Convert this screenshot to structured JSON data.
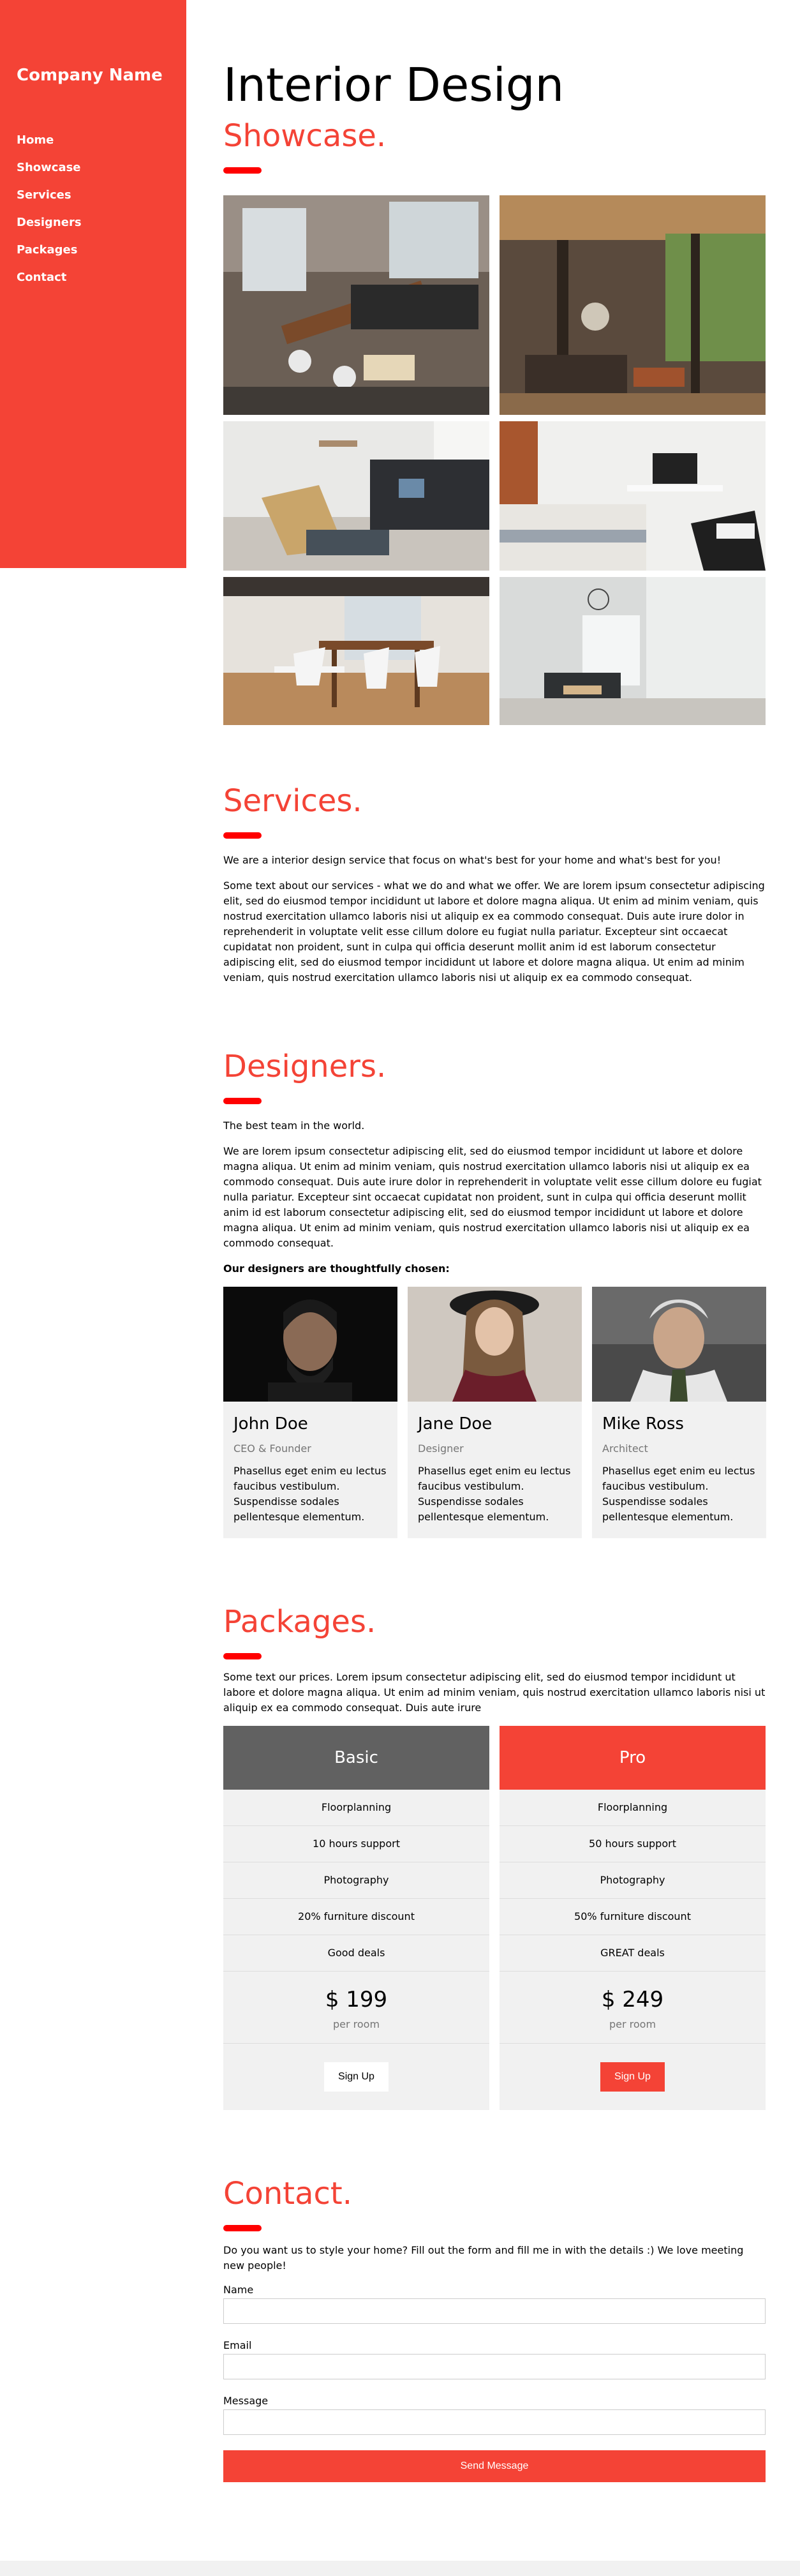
{
  "sidebar": {
    "brand": "Company Name",
    "nav": [
      "Home",
      "Showcase",
      "Services",
      "Designers",
      "Packages",
      "Contact"
    ]
  },
  "header": {
    "title": "Interior Design",
    "subtitle": "Showcase."
  },
  "services": {
    "title": "Services.",
    "intro": "We are a interior design service that focus on what's best for your home and what's best for you!",
    "body": "Some text about our services - what we do and what we offer. We are lorem ipsum consectetur adipiscing elit, sed do eiusmod tempor incididunt ut labore et dolore magna aliqua. Ut enim ad minim veniam, quis nostrud exercitation ullamco laboris nisi ut aliquip ex ea commodo consequat. Duis aute irure dolor in reprehenderit in voluptate velit esse cillum dolore eu fugiat nulla pariatur. Excepteur sint occaecat cupidatat non proident, sunt in culpa qui officia deserunt mollit anim id est laborum consectetur adipiscing elit, sed do eiusmod tempor incididunt ut labore et dolore magna aliqua. Ut enim ad minim veniam, quis nostrud exercitation ullamco laboris nisi ut aliquip ex ea commodo consequat."
  },
  "designers": {
    "title": "Designers.",
    "intro": "The best team in the world.",
    "body": "We are lorem ipsum consectetur adipiscing elit, sed do eiusmod tempor incididunt ut labore et dolore magna aliqua. Ut enim ad minim veniam, quis nostrud exercitation ullamco laboris nisi ut aliquip ex ea commodo consequat. Duis aute irure dolor in reprehenderit in voluptate velit esse cillum dolore eu fugiat nulla pariatur. Excepteur sint occaecat cupidatat non proident, sunt in culpa qui officia deserunt mollit anim id est laborum consectetur adipiscing elit, sed do eiusmod tempor incididunt ut labore et dolore magna aliqua. Ut enim ad minim veniam, quis nostrud exercitation ullamco laboris nisi ut aliquip ex ea commodo consequat.",
    "lead": "Our designers are thoughtfully chosen:",
    "team": [
      {
        "name": "John Doe",
        "role": "CEO & Founder",
        "bio": "Phasellus eget enim eu lectus faucibus vestibulum. Suspendisse sodales pellentesque elementum."
      },
      {
        "name": "Jane Doe",
        "role": "Designer",
        "bio": "Phasellus eget enim eu lectus faucibus vestibulum. Suspendisse sodales pellentesque elementum."
      },
      {
        "name": "Mike Ross",
        "role": "Architect",
        "bio": "Phasellus eget enim eu lectus faucibus vestibulum. Suspendisse sodales pellentesque elementum."
      }
    ]
  },
  "packages": {
    "title": "Packages.",
    "intro": "Some text our prices. Lorem ipsum consectetur adipiscing elit, sed do eiusmod tempor incididunt ut labore et dolore magna aliqua. Ut enim ad minim veniam, quis nostrud exercitation ullamco laboris nisi ut aliquip ex ea commodo consequat. Duis aute irure",
    "plans": [
      {
        "name": "Basic",
        "features": [
          "Floorplanning",
          "10 hours support",
          "Photography",
          "20% furniture discount",
          "Good deals"
        ],
        "price": "$ 199",
        "per": "per room",
        "cta": "Sign Up"
      },
      {
        "name": "Pro",
        "features": [
          "Floorplanning",
          "50 hours support",
          "Photography",
          "50% furniture discount",
          "GREAT deals"
        ],
        "price": "$ 249",
        "per": "per room",
        "cta": "Sign Up"
      }
    ]
  },
  "contact": {
    "title": "Contact.",
    "intro": "Do you want us to style your home? Fill out the form and fill me in with the details :) We love meeting new people!",
    "fields": [
      "Name",
      "Email",
      "Message"
    ],
    "submit": "Send Message"
  },
  "colors": {
    "accent": "#f44336",
    "basic_header": "#616161",
    "panel": "#f1f1f1"
  }
}
